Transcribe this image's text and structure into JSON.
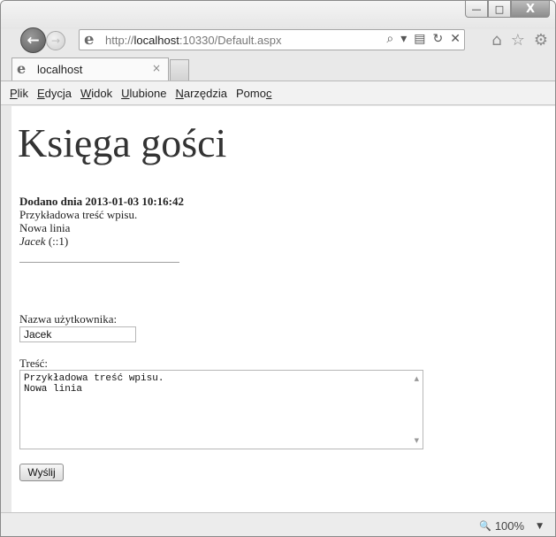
{
  "window": {
    "controls": {
      "minimize": "—",
      "maximize": "□",
      "close": "X"
    }
  },
  "address": {
    "url_prefix": "http://",
    "url_host": "localhost",
    "url_rest": ":10330/Default.aspx",
    "search_icon": "⌕",
    "dropdown_icon": "▾",
    "compat_icon": "▤",
    "refresh_icon": "↻",
    "stop_icon": "✕"
  },
  "toolbar_icons": {
    "home": "⌂",
    "favorites": "☆",
    "tools": "⚙"
  },
  "tab": {
    "label": "localhost",
    "close": "×"
  },
  "menu": [
    {
      "u": "P",
      "rest": "lik"
    },
    {
      "u": "E",
      "rest": "dycja"
    },
    {
      "u": "W",
      "rest": "idok"
    },
    {
      "u": "U",
      "rest": "lubione"
    },
    {
      "u": "N",
      "rest": "arzędzia"
    },
    {
      "pre": "Pomo",
      "u": "c"
    }
  ],
  "page": {
    "title": "Księga gości",
    "entry": {
      "date": "Dodano dnia 2013-01-03 10:16:42",
      "line1": "Przykładowa treść wpisu.",
      "line2": "Nowa linia",
      "author": "Jacek",
      "ip": " (::1)"
    },
    "form": {
      "username_label": "Nazwa użytkownika:",
      "username_value": "Jacek",
      "content_label": "Treść:",
      "content_value": "Przykładowa treść wpisu.\nNowa linia",
      "submit_label": "Wyślij"
    }
  },
  "status": {
    "zoom": "100%",
    "zoom_icon": "🔍",
    "zoom_arrow": "▼"
  }
}
